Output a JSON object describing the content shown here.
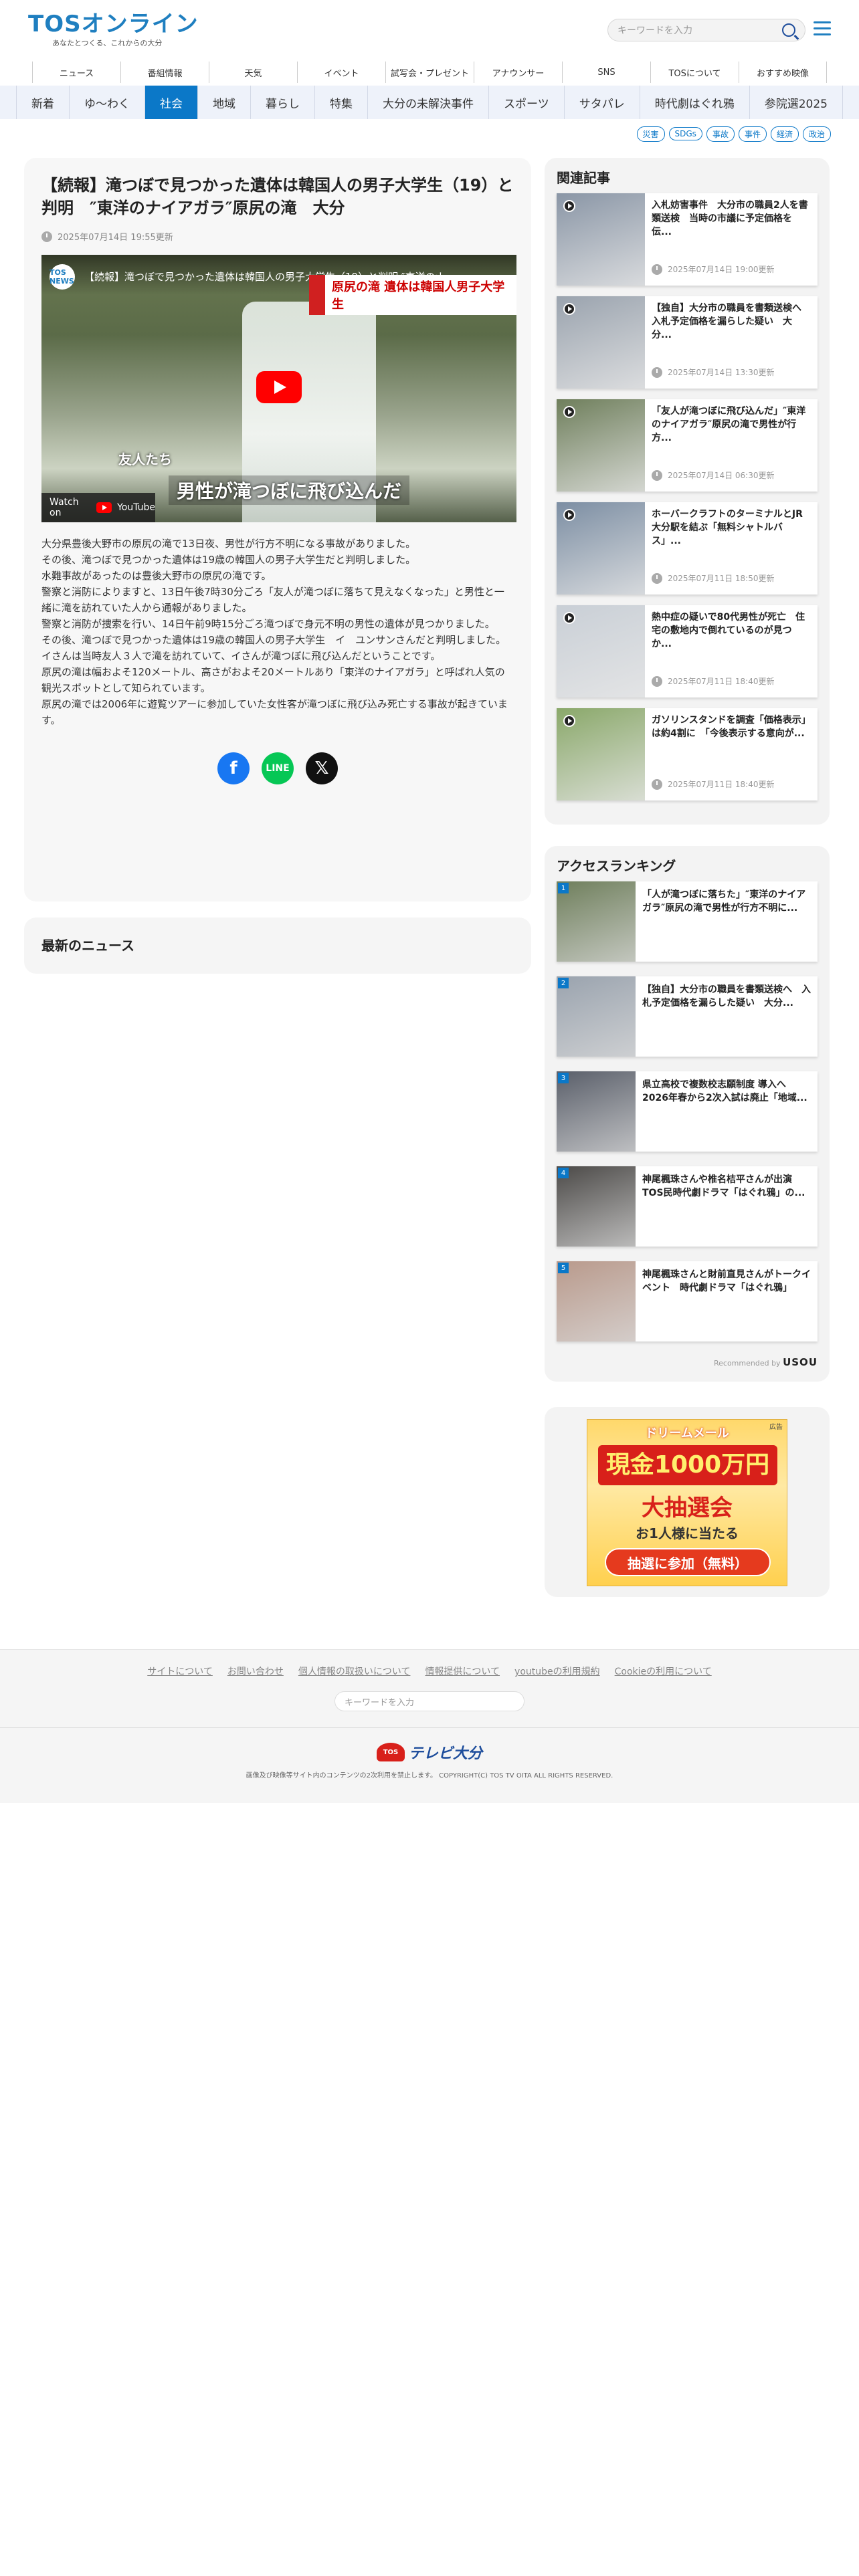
{
  "header": {
    "logo_text": "TOSオンライン",
    "tagline": "あなたとつくる、これからの大分",
    "search_placeholder": "キーワードを入力"
  },
  "nav_primary": [
    "ニュース",
    "番組情報",
    "天気",
    "イベント",
    "試写会・プレゼント",
    "アナウンサー",
    "SNS",
    "TOSについて",
    "おすすめ映像"
  ],
  "nav_secondary": {
    "items": [
      "新着",
      "ゆ〜わく",
      "社会",
      "地域",
      "暮らし",
      "特集",
      "大分の未解決事件",
      "スポーツ",
      "サタパレ",
      "時代劇はぐれ鴉",
      "参院選2025"
    ],
    "active": "社会"
  },
  "tags": [
    "災害",
    "SDGs",
    "事故",
    "事件",
    "経済",
    "政治"
  ],
  "article": {
    "title": "【続報】滝つぼで見つかった遺体は韓国人の男子大学生（19）と判明　″東洋のナイアガラ″原尻の滝　大分",
    "date": "2025年07月14日 19:55更新",
    "video": {
      "channel": "TOS NEWS",
      "title": "【続報】滝つぼで見つかった遺体は韓国人の男子大学生（19）と判明 ″東洋のナイアガラ″原尻の滝 大分",
      "banner": "原尻の滝 遺体は韓国人男子大学生",
      "caption_small": "友人たち",
      "caption_big": "男性が滝つぼに飛び込んだ",
      "watch_on": "Watch on",
      "youtube": "YouTube"
    },
    "paragraphs": [
      "大分県豊後大野市の原尻の滝で13日夜、男性が行方不明になる事故がありました。",
      "その後、滝つぼで見つかった遺体は19歳の韓国人の男子大学生だと判明しました。",
      "水難事故があったのは豊後大野市の原尻の滝です。",
      "警察と消防によりますと、13日午後7時30分ごろ「友人が滝つぼに落ちて見えなくなった」と男性と一緒に滝を訪れていた人から通報がありました。",
      "警察と消防が捜索を行い、14日午前9時15分ごろ滝つぼで身元不明の男性の遺体が見つかりました。",
      "その後、滝つぼで見つかった遺体は19歳の韓国人の男子大学生　イ　ユンサンさんだと判明しました。",
      "イさんは当時友人３人で滝を訪れていて、イさんが滝つぼに飛び込んだということです。",
      "原尻の滝は幅およそ120メートル、高さがおよそ20メートルあり「東洋のナイアガラ」と呼ばれ人気の観光スポットとして知られています。",
      "原尻の滝では2006年に遊覧ツアーに参加していた女性客が滝つぼに飛び込み死亡する事故が起きています。"
    ],
    "share_line_label": "LINE"
  },
  "latest_news": {
    "heading": "最新のニュース"
  },
  "related": {
    "heading": "関連記事",
    "items": [
      {
        "title": "入札妨害事件　大分市の職員2人を書類送検　当時の市議に予定価格を伝...",
        "date": "2025年07月14日 19:00更新",
        "thumb_color": "#8a96a6"
      },
      {
        "title": "【独自】大分市の職員を書類送検へ　入札予定価格を漏らした疑い　大分...",
        "date": "2025年07月14日 13:30更新",
        "thumb_color": "#9aa3ae"
      },
      {
        "title": "「友人が滝つぼに飛び込んだ」″東洋のナイアガラ″原尻の滝で男性が行方...",
        "date": "2025年07月14日 06:30更新",
        "thumb_color": "#6f7f5c"
      },
      {
        "title": "ホーバークラフトのターミナルとJR大分駅を結ぶ「無料シャトルバス」...",
        "date": "2025年07月11日 18:50更新",
        "thumb_color": "#7c8ea3"
      },
      {
        "title": "熱中症の疑いで80代男性が死亡　住宅の敷地内で倒れているのが見つか...",
        "date": "2025年07月11日 18:40更新",
        "thumb_color": "#c9cfd6"
      },
      {
        "title": "ガソリンスタンドを調査「価格表示」は約4割に　「今後表示する意向が...",
        "date": "2025年07月11日 18:40更新",
        "thumb_color": "#8aa86a"
      }
    ]
  },
  "ranking": {
    "heading": "アクセスランキング",
    "items": [
      {
        "rank": "1",
        "title": "「人が滝つぼに落ちた」″東洋のナイアガラ″原尻の滝で男性が行方不明に...",
        "thumb_color": "#6f7f5c"
      },
      {
        "rank": "2",
        "title": "【独自】大分市の職員を書類送検へ　入札予定価格を漏らした疑い　大分...",
        "thumb_color": "#9aa3ae"
      },
      {
        "rank": "3",
        "title": "県立高校で複数校志願制度 導入へ　2026年春から2次入試は廃止「地域...",
        "thumb_color": "#5a5f6a"
      },
      {
        "rank": "4",
        "title": "神尾楓珠さんや椎名桔平さんが出演　TOS民時代劇ドラマ「はぐれ鴉」の...",
        "thumb_color": "#4c4a48"
      },
      {
        "rank": "5",
        "title": "神尾楓珠さんと財前直見さんがトークイベント　時代劇ドラマ「はぐれ鴉」",
        "thumb_color": "#b99a8c"
      }
    ],
    "recommended_by": "Recommended by",
    "recommended_brand": "USOU"
  },
  "ad": {
    "label": "広告",
    "brand": "ドリームメール",
    "big": "現金1000万円",
    "mid": "大抽選会",
    "small": "お1人様に当たる",
    "cta": "抽選に参加（無料）"
  },
  "footer": {
    "links": [
      "サイトについて",
      "お問い合わせ",
      "個人情報の取扱いについて",
      "情報提供について",
      "youtubeの利用規約",
      "Cookieの利用について"
    ],
    "search_placeholder": "キーワードを入力",
    "logo_mark": "TOS",
    "logo_name": "テレビ大分",
    "copyright": "画像及び映像等サイト内のコンテンツの2次利用を禁止します。 COPYRIGHT(C) TOS TV OITA ALL RIGHTS RESERVED."
  }
}
